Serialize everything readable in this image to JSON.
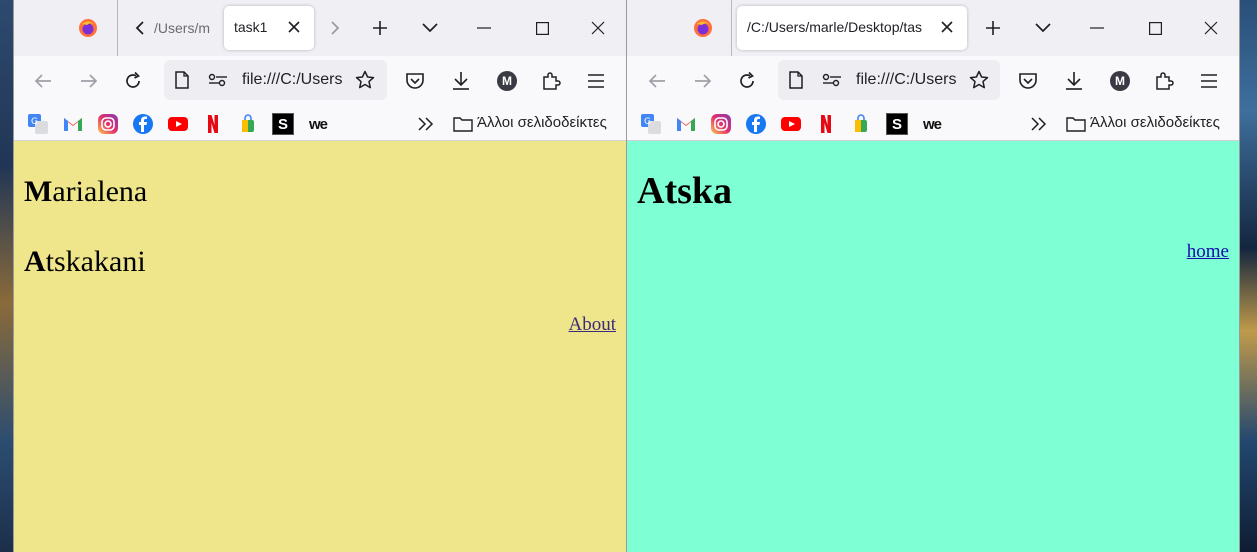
{
  "left_window": {
    "tabs": {
      "prev_tab_text": "/Users/m",
      "active_tab_label": "task1"
    },
    "toolbar": {
      "url_text": "file:///C:/Users"
    },
    "bookmarks": {
      "items": [
        "Google Translate",
        "Gmail",
        "Instagram",
        "Facebook",
        "YouTube",
        "Netflix",
        "Shopping",
        "S",
        "we"
      ],
      "s_label": "S",
      "we_label": "we",
      "other_bookmarks": "Άλλοι σελιδοδείκτες"
    },
    "page": {
      "line1_initial": "M",
      "line1_rest": "arialena",
      "line2_initial": "A",
      "line2_rest": "tskakani",
      "link_text": "About",
      "background": "#efe58a"
    }
  },
  "right_window": {
    "tabs": {
      "active_tab_label": "/C:/Users/marle/Desktop/tas"
    },
    "toolbar": {
      "url_text": "file:///C:/Users"
    },
    "bookmarks": {
      "s_label": "S",
      "we_label": "we",
      "other_bookmarks": "Άλλοι σελιδοδείκτες"
    },
    "page": {
      "heading": "Atska",
      "link_text": "home",
      "background": "#7fffd4"
    }
  },
  "account_initial": "M",
  "icons": {
    "back": "arrow-left-icon",
    "forward": "arrow-right-icon",
    "reload": "reload-icon",
    "page": "page-icon",
    "permissions": "permissions-icon",
    "bookmark_star": "star-icon",
    "pocket": "pocket-icon",
    "downloads": "download-icon",
    "extensions": "puzzle-icon",
    "menu": "hamburger-icon",
    "new_tab": "plus-icon",
    "list_tabs": "chevron-down-icon",
    "minimize": "minimize-icon",
    "maximize": "maximize-icon",
    "close": "close-icon"
  }
}
